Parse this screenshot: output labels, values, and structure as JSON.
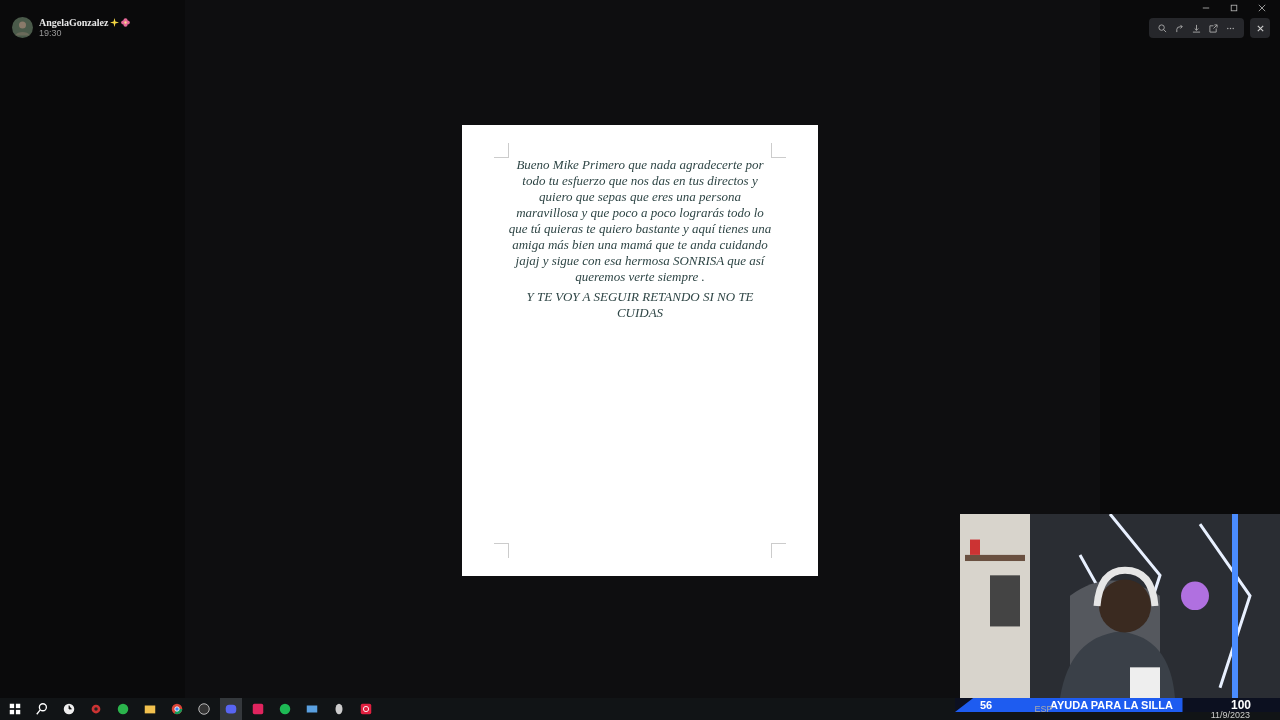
{
  "header": {
    "user_name": "AngelaGonzalez",
    "time": "19:30"
  },
  "document": {
    "paragraphs": [
      "Bueno Mike Primero que nada agradecerte por todo tu esfuerzo que nos das en tus directos y quiero que sepas que eres una persona maravillosa y que poco a poco lograrás todo lo que tú quieras te quiero bastante y aquí tienes una amiga más bien una mamá que te anda cuidando jajaj y sigue con esa hermosa SONRISA que así queremos  verte siempre .",
      "Y TE VOY A SEGUIR RETANDO SI NO TE CUIDAS"
    ]
  },
  "stream_goal": {
    "current": "56",
    "title": "AYUDA PARA LA SILLA",
    "target": "100",
    "level": 0.7
  },
  "taskbar": {
    "language": "ESP",
    "date": "11/9/2023"
  }
}
